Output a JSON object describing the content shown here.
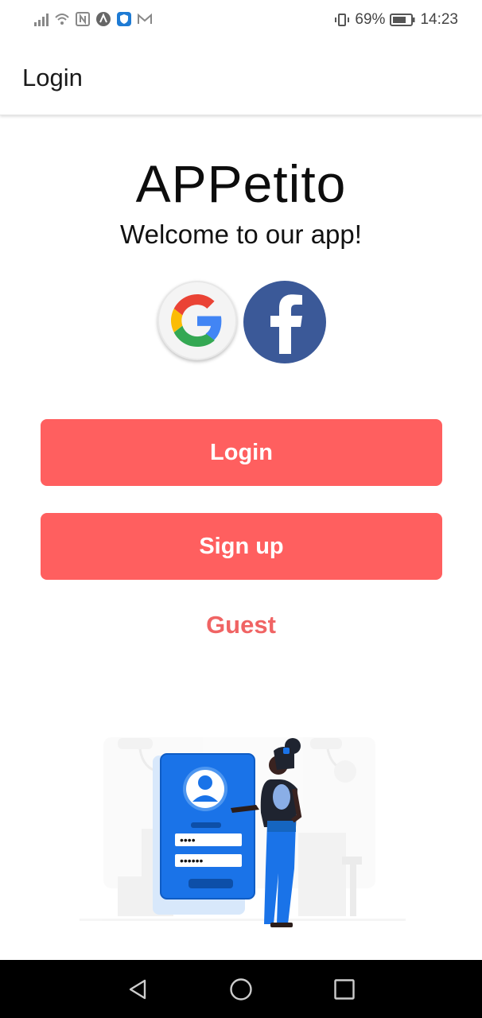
{
  "status_bar": {
    "battery_percent": "69%",
    "time": "14:23",
    "left_icons": [
      "signal-icon",
      "wifi-icon",
      "nfc-icon",
      "app-a-icon",
      "shield-app-icon",
      "mail-m-icon"
    ],
    "right_icons": [
      "vibrate-icon",
      "battery-icon"
    ]
  },
  "app_bar": {
    "title": "Login"
  },
  "main": {
    "app_name": "APPetito",
    "welcome": "Welcome to our app!",
    "social": {
      "google_icon": "google-icon",
      "facebook_icon": "facebook-icon"
    },
    "login_label": "Login",
    "signup_label": "Sign up",
    "guest_label": "Guest",
    "illustration": {
      "dots_short": "••••",
      "dots_long": "••••••"
    }
  },
  "nav_bar": {
    "icons": [
      "back-icon",
      "home-icon",
      "recents-icon"
    ]
  },
  "colors": {
    "accent": "#ff5f5f",
    "guest_text": "#f06464",
    "facebook": "#3b5998",
    "illustration_blue": "#1a73e8"
  }
}
